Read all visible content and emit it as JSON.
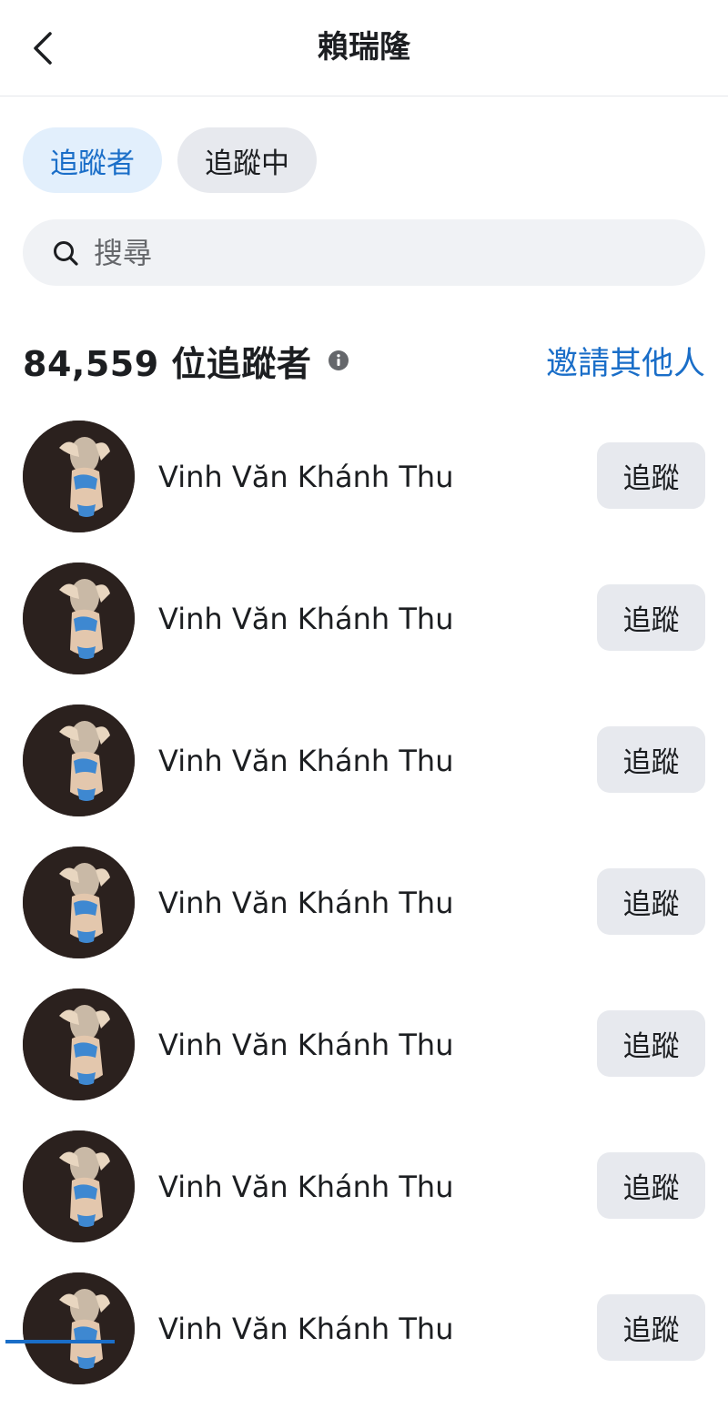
{
  "header": {
    "title": "賴瑞隆"
  },
  "tabs": [
    {
      "label": "追蹤者",
      "active": true
    },
    {
      "label": "追蹤中",
      "active": false
    }
  ],
  "search": {
    "placeholder": "搜尋",
    "value": ""
  },
  "summary": {
    "count_text": "84,559 位追蹤者",
    "invite_label": "邀請其他人"
  },
  "followers": [
    {
      "name": "Vinh Văn Khánh Thu",
      "button": "追蹤"
    },
    {
      "name": "Vinh Văn Khánh Thu",
      "button": "追蹤"
    },
    {
      "name": "Vinh Văn Khánh Thu",
      "button": "追蹤"
    },
    {
      "name": "Vinh Văn Khánh Thu",
      "button": "追蹤"
    },
    {
      "name": "Vinh Văn Khánh Thu",
      "button": "追蹤"
    },
    {
      "name": "Vinh Văn Khánh Thu",
      "button": "追蹤"
    },
    {
      "name": "Vinh Văn Khánh Thu",
      "button": "追蹤"
    }
  ],
  "icons": {
    "back": "chevron-left-icon",
    "search": "search-icon",
    "info": "info-icon"
  },
  "colors": {
    "accent": "#1a6ec8",
    "active_tab_bg": "#e2effc",
    "button_bg": "#e7e9ee",
    "search_bg": "#f0f2f5"
  }
}
